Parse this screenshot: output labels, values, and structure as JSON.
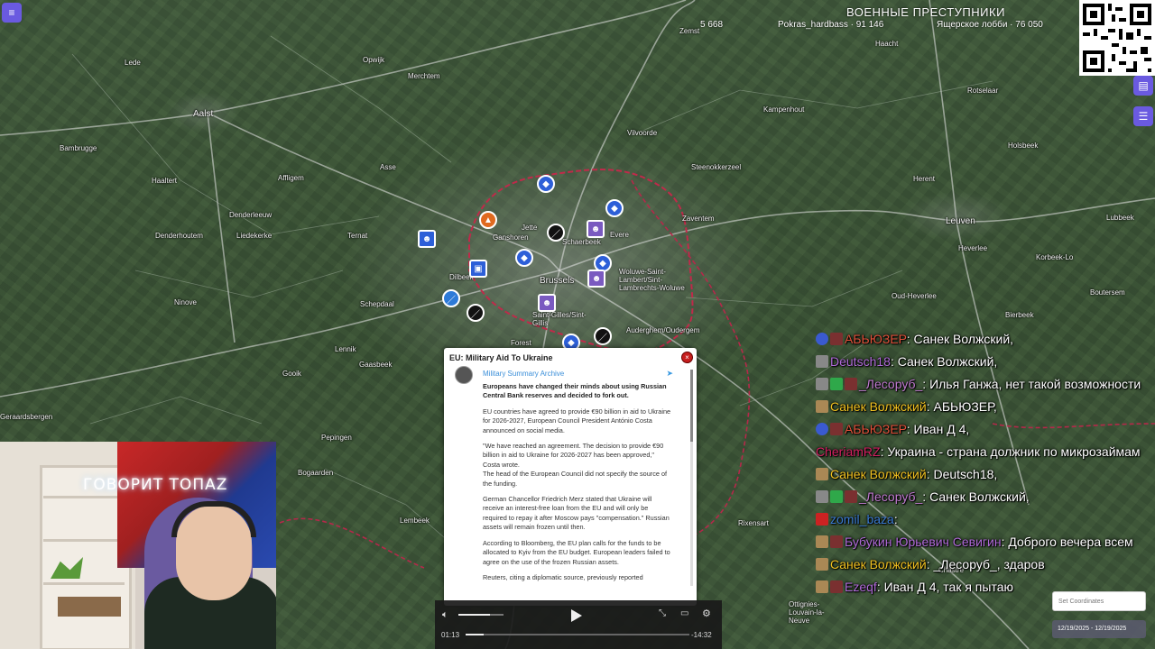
{
  "hud": {
    "title": "ВОЕННЫЕ ПРЕСТУПНИКИ",
    "count_left": "5 668",
    "player_a": "Pokras_hardbass · 91 146",
    "player_b": "Ящерское лобби · 76 050"
  },
  "cities": [
    {
      "name": "Aalst",
      "big": true
    },
    {
      "name": "Lede"
    },
    {
      "name": "Opwijk"
    },
    {
      "name": "Merchtem"
    },
    {
      "name": "Zemst"
    },
    {
      "name": "Haacht"
    },
    {
      "name": "Rotselaar"
    },
    {
      "name": "Kampenhout"
    },
    {
      "name": "Holsbeek"
    },
    {
      "name": "Vilvoorde"
    },
    {
      "name": "Steenokkerzeel"
    },
    {
      "name": "Herent"
    },
    {
      "name": "Leuven",
      "big": true
    },
    {
      "name": "Lubbeek"
    },
    {
      "name": "Bambrugge"
    },
    {
      "name": "Haaltert"
    },
    {
      "name": "Affligem"
    },
    {
      "name": "Asse"
    },
    {
      "name": "Denderleeuw"
    },
    {
      "name": "Liedekerke"
    },
    {
      "name": "Denderhoutem"
    },
    {
      "name": "Ternat"
    },
    {
      "name": "Jette"
    },
    {
      "name": "Ganshoren"
    },
    {
      "name": "Schaerbeek"
    },
    {
      "name": "Evere"
    },
    {
      "name": "Zaventem"
    },
    {
      "name": "Dilbeek"
    },
    {
      "name": "Brussels",
      "big": true
    },
    {
      "name": "Woluwe-Saint-Lambert/Sint-Lambrechts-Woluwe"
    },
    {
      "name": "Heverlee"
    },
    {
      "name": "Korbeek-Lo"
    },
    {
      "name": "Ninove"
    },
    {
      "name": "Schepdaal"
    },
    {
      "name": "Oud-Heverlee"
    },
    {
      "name": "Bierbeek"
    },
    {
      "name": "Boutersem"
    },
    {
      "name": "Saint-Gilles/Sint-Gillis"
    },
    {
      "name": "Auderghem/Oudergem"
    },
    {
      "name": "Forest"
    },
    {
      "name": "Lennik"
    },
    {
      "name": "Gaasbeek"
    },
    {
      "name": "Gooik"
    },
    {
      "name": "Geraardsbergen"
    },
    {
      "name": "Pepingen"
    },
    {
      "name": "Bogaarden"
    },
    {
      "name": "Lembeek"
    },
    {
      "name": "Rixensart"
    },
    {
      "name": "Ottignies-Louvain-la-Neuve"
    },
    {
      "name": "Chastre"
    }
  ],
  "popup": {
    "title": "EU: Military Aid To Ukraine",
    "source": "Military Summary Archive",
    "lead": "Europeans have changed their minds about using Russian Central Bank reserves and decided to fork out.",
    "paragraphs": [
      "EU countries have agreed to provide €90 billion in aid to Ukraine for 2026-2027, European Council President António Costa announced on social media.",
      "\"We have reached an agreement. The decision to provide €90 billion in aid to Ukraine for 2026-2027 has been approved,\" Costa wrote.\nThe head of the European Council did not specify the source of the funding.",
      "German Chancellor Friedrich Merz stated that Ukraine will receive an interest-free loan from the EU and will only be required to repay it after Moscow pays \"compensation.\" Russian assets will remain frozen until then.",
      "According to Bloomberg, the EU plan calls for the funds to be allocated to Kyiv from the EU budget. European leaders failed to agree on the use of the frozen Russian assets.",
      "Reuters, citing a diplomatic source, previously reported"
    ],
    "close_icon": "×"
  },
  "player": {
    "elapsed": "01:13",
    "remaining": "-14:32",
    "progress": 0.08,
    "volume": 0.7
  },
  "webcam": {
    "neon_text": "ГОВОРИТ ТОПАZ"
  },
  "chat": [
    {
      "user": "АБЬЮЗЕР",
      "user_color": "#e0503a",
      "text": "Санек Волжский,",
      "badges": [
        "#3a5ad0",
        "#7a3030"
      ]
    },
    {
      "user": "Deutsch18",
      "user_color": "#b06ad8",
      "text": "Санек Волжский,",
      "badges": [
        "#888888"
      ]
    },
    {
      "user": "_Лесоруб_",
      "user_color": "#c07ad0",
      "text": "Илья Ганжа, нет такой возможности",
      "badges": [
        "#888888",
        "#2fa84a",
        "#7a3030"
      ]
    },
    {
      "user": "Санек Волжский",
      "user_color": "#f0c020",
      "text": "АБЬЮЗЕР,",
      "badges": [
        "#aa8855"
      ]
    },
    {
      "user": "АБЬЮЗЕР",
      "user_color": "#e0503a",
      "text": "Иван Д 4,",
      "badges": [
        "#3a5ad0",
        "#7a3030"
      ]
    },
    {
      "user": "CheriamRZ",
      "user_color": "#d02060",
      "text": "Украина - страна должник по микрозаймам",
      "badges": []
    },
    {
      "user": "Санек Волжский",
      "user_color": "#f0c020",
      "text": "Deutsch18,",
      "badges": [
        "#aa8855"
      ]
    },
    {
      "user": "_Лесоруб_",
      "user_color": "#c07ad0",
      "text": "Санек Волжский,",
      "badges": [
        "#888888",
        "#2fa84a",
        "#7a3030"
      ]
    },
    {
      "user": "zomil_baza",
      "user_color": "#3a7ad0",
      "text": "",
      "badges": [
        "#cc2222"
      ]
    },
    {
      "user": "Бубукин Юрьевич Севигин",
      "user_color": "#b06ad8",
      "text": "Доброго вечера всем",
      "badges": [
        "#aa8855",
        "#7a3030"
      ]
    },
    {
      "user": "Санек Волжский",
      "user_color": "#f0c020",
      "text": "_Лесоруб_, здаров",
      "badges": [
        "#aa8855"
      ]
    },
    {
      "user": "Ezeqf",
      "user_color": "#b06ad8",
      "text": "Иван Д 4, так я пытаю",
      "badges": [
        "#aa8855",
        "#7a3030"
      ]
    }
  ],
  "coords": {
    "placeholder": "Set Coordinates",
    "dates": "12/19/2025 - 12/19/2025"
  }
}
